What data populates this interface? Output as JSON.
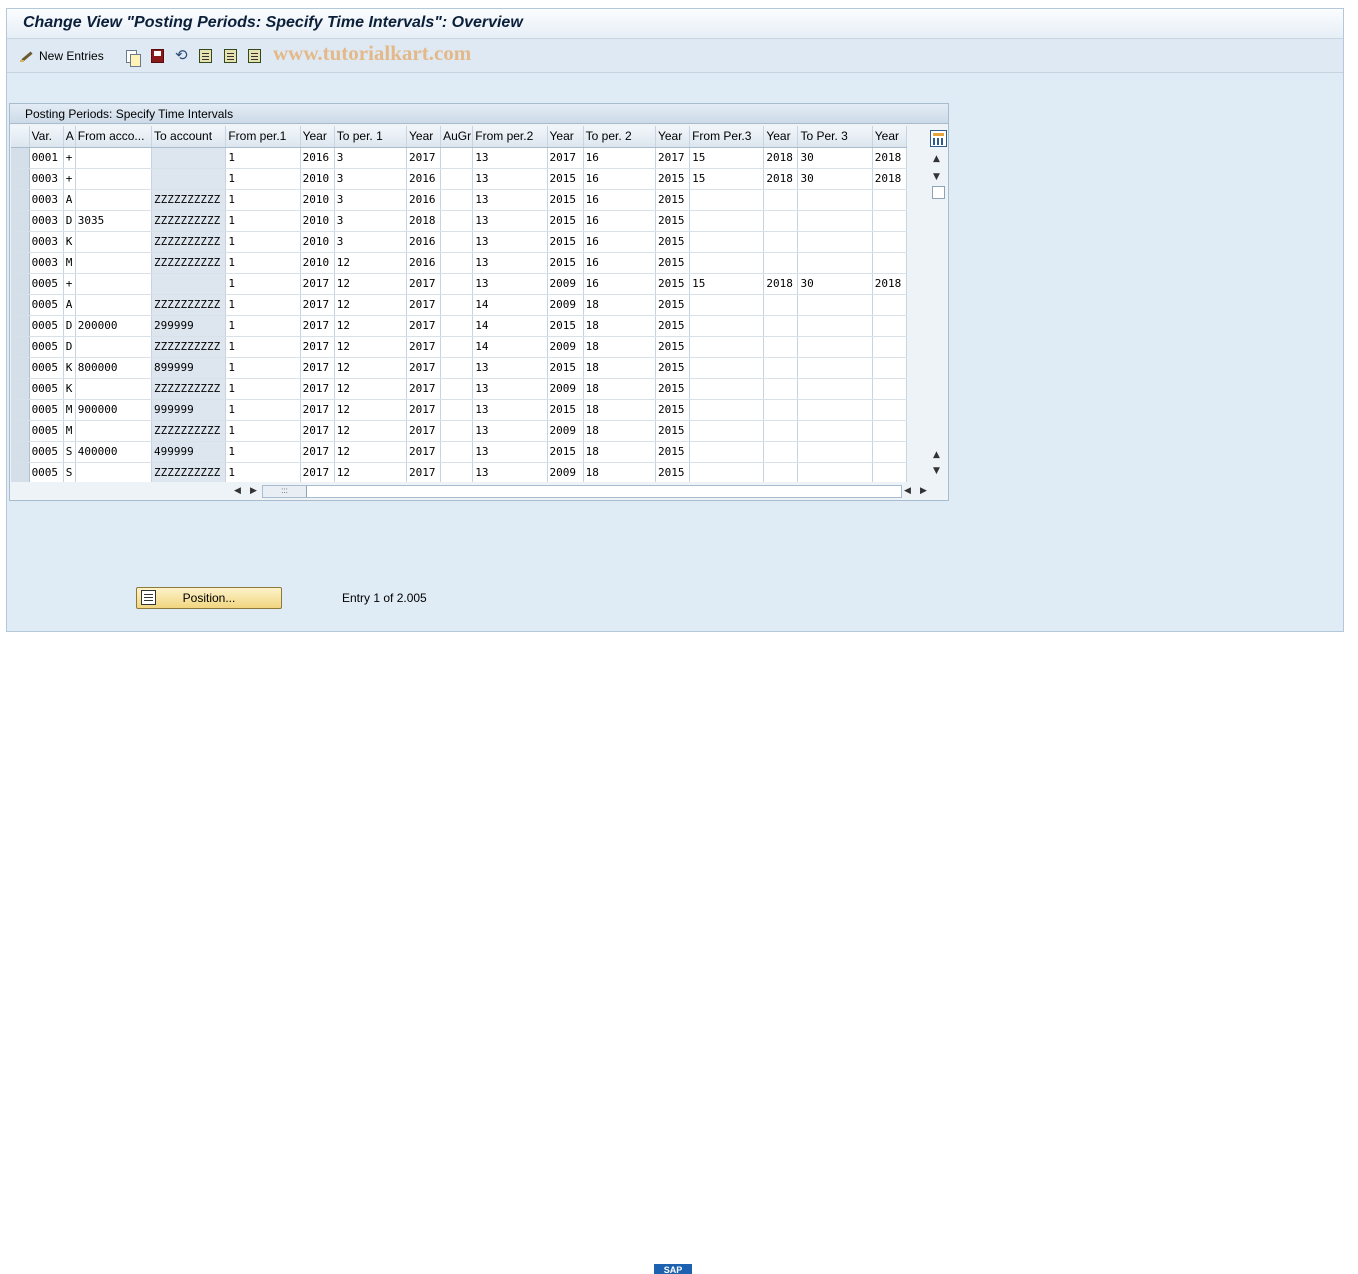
{
  "window": {
    "title": "Change View \"Posting Periods: Specify Time Intervals\": Overview"
  },
  "toolbar": {
    "new_entries_label": "New Entries",
    "watermark": "www.tutorialkart.com"
  },
  "panel": {
    "title": "Posting Periods: Specify Time Intervals"
  },
  "table": {
    "columns": [
      "Var.",
      "A",
      "From acco...",
      "To account",
      "From per.1",
      "Year",
      "To per. 1",
      "Year",
      "AuGr",
      "From per.2",
      "Year",
      "To per. 2",
      "Year",
      "From Per.3",
      "Year",
      "To Per. 3",
      "Year"
    ],
    "rows": [
      [
        "0001",
        "+",
        "",
        "",
        "1",
        "2016",
        "3",
        "2017",
        "",
        "13",
        "2017",
        "16",
        "2017",
        "15",
        "2018",
        "30",
        "2018"
      ],
      [
        "0003",
        "+",
        "",
        "",
        "1",
        "2010",
        "3",
        "2016",
        "",
        "13",
        "2015",
        "16",
        "2015",
        "15",
        "2018",
        "30",
        "2018"
      ],
      [
        "0003",
        "A",
        "",
        "ZZZZZZZZZZ",
        "1",
        "2010",
        "3",
        "2016",
        "",
        "13",
        "2015",
        "16",
        "2015",
        "",
        "",
        "",
        ""
      ],
      [
        "0003",
        "D",
        "3035",
        "ZZZZZZZZZZ",
        "1",
        "2010",
        "3",
        "2018",
        "",
        "13",
        "2015",
        "16",
        "2015",
        "",
        "",
        "",
        ""
      ],
      [
        "0003",
        "K",
        "",
        "ZZZZZZZZZZ",
        "1",
        "2010",
        "3",
        "2016",
        "",
        "13",
        "2015",
        "16",
        "2015",
        "",
        "",
        "",
        ""
      ],
      [
        "0003",
        "M",
        "",
        "ZZZZZZZZZZ",
        "1",
        "2010",
        "12",
        "2016",
        "",
        "13",
        "2015",
        "16",
        "2015",
        "",
        "",
        "",
        ""
      ],
      [
        "0005",
        "+",
        "",
        "",
        "1",
        "2017",
        "12",
        "2017",
        "",
        "13",
        "2009",
        "16",
        "2015",
        "15",
        "2018",
        "30",
        "2018"
      ],
      [
        "0005",
        "A",
        "",
        "ZZZZZZZZZZ",
        "1",
        "2017",
        "12",
        "2017",
        "",
        "14",
        "2009",
        "18",
        "2015",
        "",
        "",
        "",
        ""
      ],
      [
        "0005",
        "D",
        "200000",
        "299999",
        "1",
        "2017",
        "12",
        "2017",
        "",
        "14",
        "2015",
        "18",
        "2015",
        "",
        "",
        "",
        ""
      ],
      [
        "0005",
        "D",
        "",
        "ZZZZZZZZZZ",
        "1",
        "2017",
        "12",
        "2017",
        "",
        "14",
        "2009",
        "18",
        "2015",
        "",
        "",
        "",
        ""
      ],
      [
        "0005",
        "K",
        "800000",
        "899999",
        "1",
        "2017",
        "12",
        "2017",
        "",
        "13",
        "2015",
        "18",
        "2015",
        "",
        "",
        "",
        ""
      ],
      [
        "0005",
        "K",
        "",
        "ZZZZZZZZZZ",
        "1",
        "2017",
        "12",
        "2017",
        "",
        "13",
        "2009",
        "18",
        "2015",
        "",
        "",
        "",
        ""
      ],
      [
        "0005",
        "M",
        "900000",
        "999999",
        "1",
        "2017",
        "12",
        "2017",
        "",
        "13",
        "2015",
        "18",
        "2015",
        "",
        "",
        "",
        ""
      ],
      [
        "0005",
        "M",
        "",
        "ZZZZZZZZZZ",
        "1",
        "2017",
        "12",
        "2017",
        "",
        "13",
        "2009",
        "18",
        "2015",
        "",
        "",
        "",
        ""
      ],
      [
        "0005",
        "S",
        "400000",
        "499999",
        "1",
        "2017",
        "12",
        "2017",
        "",
        "13",
        "2015",
        "18",
        "2015",
        "",
        "",
        "",
        ""
      ],
      [
        "0005",
        "S",
        "",
        "ZZZZZZZZZZ",
        "1",
        "2017",
        "12",
        "2017",
        "",
        "13",
        "2009",
        "18",
        "2015",
        "",
        "",
        "",
        ""
      ]
    ]
  },
  "footer": {
    "position_button_label": "Position...",
    "entry_text": "Entry 1 of 2.005"
  },
  "statusbar": {
    "logo_text": "SAP"
  },
  "colors": {
    "window_bg": "#dfebf5",
    "title_text": "#0b1f3a",
    "watermark": "#e3b98a",
    "button_yellow": "#f1d680"
  }
}
